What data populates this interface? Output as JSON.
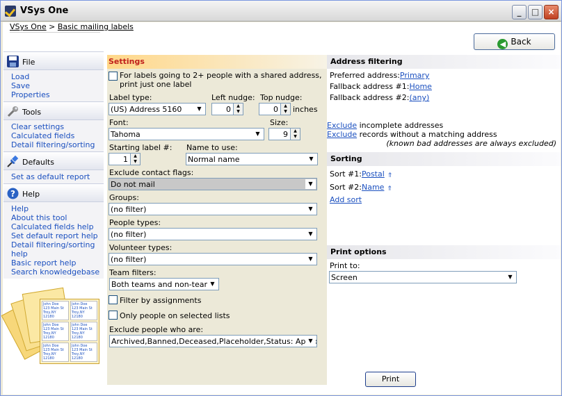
{
  "window": {
    "title": "VSys One"
  },
  "breadcrumb": {
    "root": "VSys One",
    "sep": ">",
    "current": "Basic mailing labels"
  },
  "back_label": "Back",
  "sidebar": {
    "file": {
      "title": "File",
      "items": [
        "Load",
        "Save",
        "Properties"
      ]
    },
    "tools": {
      "title": "Tools",
      "items": [
        "Clear settings",
        "Calculated fields",
        "Detail filtering/sorting"
      ]
    },
    "defaults": {
      "title": "Defaults",
      "items": [
        "Set as default report"
      ]
    },
    "help": {
      "title": "Help",
      "items": [
        "Help",
        "About this tool",
        "Calculated fields help",
        "Set default report help",
        "Detail filtering/sorting help",
        "Basic report help",
        "Search knowledgebase"
      ]
    },
    "label_sample": {
      "line1": "John Doe",
      "line2": "123 Main St",
      "line3": "Troy,NY 12180"
    }
  },
  "settings": {
    "header": "Settings",
    "shared_address_label": "For labels going to 2+ people with a shared address, print just one label",
    "label_type_label": "Label type:",
    "label_type_value": "(US) Address 5160",
    "left_nudge_label": "Left nudge:",
    "left_nudge_value": "0",
    "top_nudge_label": "Top nudge:",
    "top_nudge_value": "0",
    "inches": "inches",
    "font_label": "Font:",
    "font_value": "Tahoma",
    "size_label": "Size:",
    "size_value": "9",
    "starting_label_label": "Starting label #:",
    "starting_label_value": "1",
    "name_to_use_label": "Name to use:",
    "name_to_use_value": "Normal name",
    "exclude_flags_label": "Exclude contact flags:",
    "exclude_flags_value": "Do not mail",
    "groups_label": "Groups:",
    "groups_value": "(no filter)",
    "people_types_label": "People types:",
    "people_types_value": "(no filter)",
    "volunteer_types_label": "Volunteer types:",
    "volunteer_types_value": "(no filter)",
    "team_filters_label": "Team filters:",
    "team_filters_value": "Both teams and non-teams",
    "filter_assignments_label": "Filter by assignments",
    "only_selected_lists_label": "Only people on selected lists",
    "exclude_people_label": "Exclude people who are:",
    "exclude_people_value": "Archived,Banned,Deceased,Placeholder,Status: Applicant"
  },
  "address_filtering": {
    "header": "Address filtering",
    "preferred_label": "Preferred address:",
    "preferred_value": "Primary",
    "fallback1_label": "Fallback address #1:",
    "fallback1_value": "Home",
    "fallback2_label": "Fallback address #2:",
    "fallback2_value": "(any)",
    "exclude_link": "Exclude",
    "incomplete_text": "incomplete addresses",
    "without_text": "records without a matching address",
    "note": "(known bad addresses are always excluded)"
  },
  "sorting": {
    "header": "Sorting",
    "sort1_label": "Sort #1:",
    "sort1_value": "Postal",
    "sort2_label": "Sort #2:",
    "sort2_value": "Name",
    "add_sort": "Add sort"
  },
  "print_options": {
    "header": "Print options",
    "print_to_label": "Print to:",
    "print_to_value": "Screen"
  },
  "print_button": "Print",
  "icons": {
    "back": "back-arrow-icon",
    "file": "floppy-disk-icon",
    "tools": "wrench-icon",
    "defaults": "pushpin-icon",
    "help": "help-icon"
  }
}
